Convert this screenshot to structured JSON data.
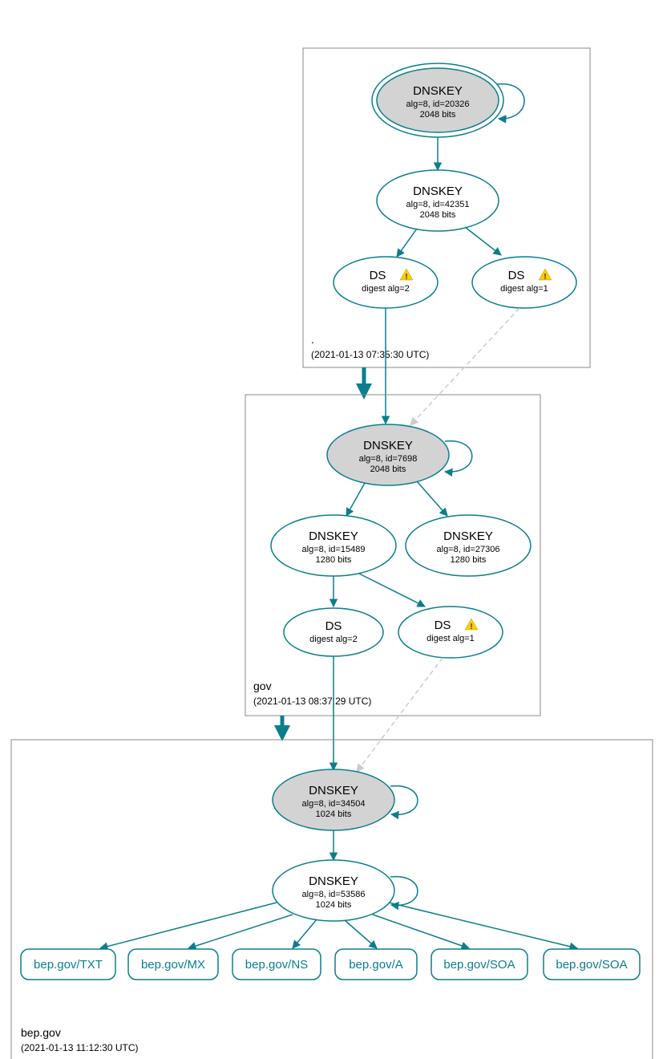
{
  "zones": {
    "root": {
      "label": ".",
      "timestamp": "(2021-01-13 07:35:30 UTC)"
    },
    "gov": {
      "label": "gov",
      "timestamp": "(2021-01-13 08:37:29 UTC)"
    },
    "bep": {
      "label": "bep.gov",
      "timestamp": "(2021-01-13 11:12:30 UTC)"
    }
  },
  "nodes": {
    "root_ksk": {
      "title": "DNSKEY",
      "line2": "alg=8, id=20326",
      "line3": "2048 bits"
    },
    "root_zsk": {
      "title": "DNSKEY",
      "line2": "alg=8, id=42351",
      "line3": "2048 bits"
    },
    "root_ds2": {
      "title": "DS",
      "line2": "digest alg=2",
      "warn": true
    },
    "root_ds1": {
      "title": "DS",
      "line2": "digest alg=1",
      "warn": true
    },
    "gov_ksk": {
      "title": "DNSKEY",
      "line2": "alg=8, id=7698",
      "line3": "2048 bits"
    },
    "gov_zsk1": {
      "title": "DNSKEY",
      "line2": "alg=8, id=15489",
      "line3": "1280 bits"
    },
    "gov_zsk2": {
      "title": "DNSKEY",
      "line2": "alg=8, id=27306",
      "line3": "1280 bits"
    },
    "gov_ds2": {
      "title": "DS",
      "line2": "digest alg=2"
    },
    "gov_ds1": {
      "title": "DS",
      "line2": "digest alg=1",
      "warn": true
    },
    "bep_ksk": {
      "title": "DNSKEY",
      "line2": "alg=8, id=34504",
      "line3": "1024 bits"
    },
    "bep_zsk": {
      "title": "DNSKEY",
      "line2": "alg=8, id=53586",
      "line3": "1024 bits"
    }
  },
  "rr": {
    "txt": "bep.gov/TXT",
    "mx": "bep.gov/MX",
    "ns": "bep.gov/NS",
    "a": "bep.gov/A",
    "soa1": "bep.gov/SOA",
    "soa2": "bep.gov/SOA"
  }
}
